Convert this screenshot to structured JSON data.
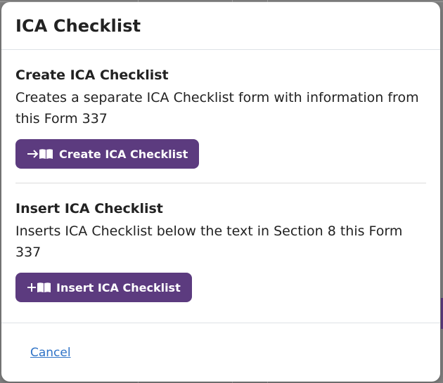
{
  "dialog": {
    "title": "ICA Checklist"
  },
  "create_section": {
    "title": "Create ICA Checklist",
    "description": "Creates a separate ICA Checklist form with information from this Form 337",
    "button_label": "Create ICA Checklist",
    "button_icon": "arrow-book-icon"
  },
  "insert_section": {
    "title": "Insert ICA Checklist",
    "description": "Inserts ICA Checklist below the text in Section 8 this Form 337",
    "button_label": "Insert ICA Checklist",
    "button_icon": "plus-book-icon"
  },
  "footer": {
    "cancel_label": "Cancel"
  },
  "colors": {
    "button_bg": "#5c3b7f",
    "link": "#2f73c7"
  }
}
